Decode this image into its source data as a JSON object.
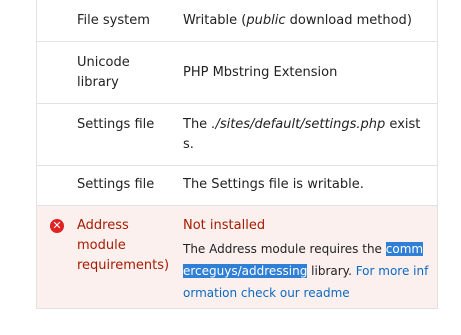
{
  "rows": [
    {
      "label": "File system",
      "value_before": "Writable (",
      "value_em": "public",
      "value_after": " download method)"
    },
    {
      "label": "Unicode library",
      "value": "PHP Mbstring Extension"
    },
    {
      "label": "Settings file",
      "value_before": "The ",
      "value_em": "./sites/default/settings.php",
      "value_after": " exists."
    },
    {
      "label": "Settings file",
      "value": "The Settings file is writable."
    }
  ],
  "error_row": {
    "icon": "error-icon",
    "label": "Address module requirements)",
    "status": "Not installed",
    "desc_before": "The Address module requires the ",
    "desc_highlight": "commerceguys/addressing",
    "desc_after": " library. ",
    "link": "For more information check our readme"
  },
  "colors": {
    "error": "#a51b00",
    "link": "#0e69be",
    "highlight": "#2f7fd6"
  }
}
